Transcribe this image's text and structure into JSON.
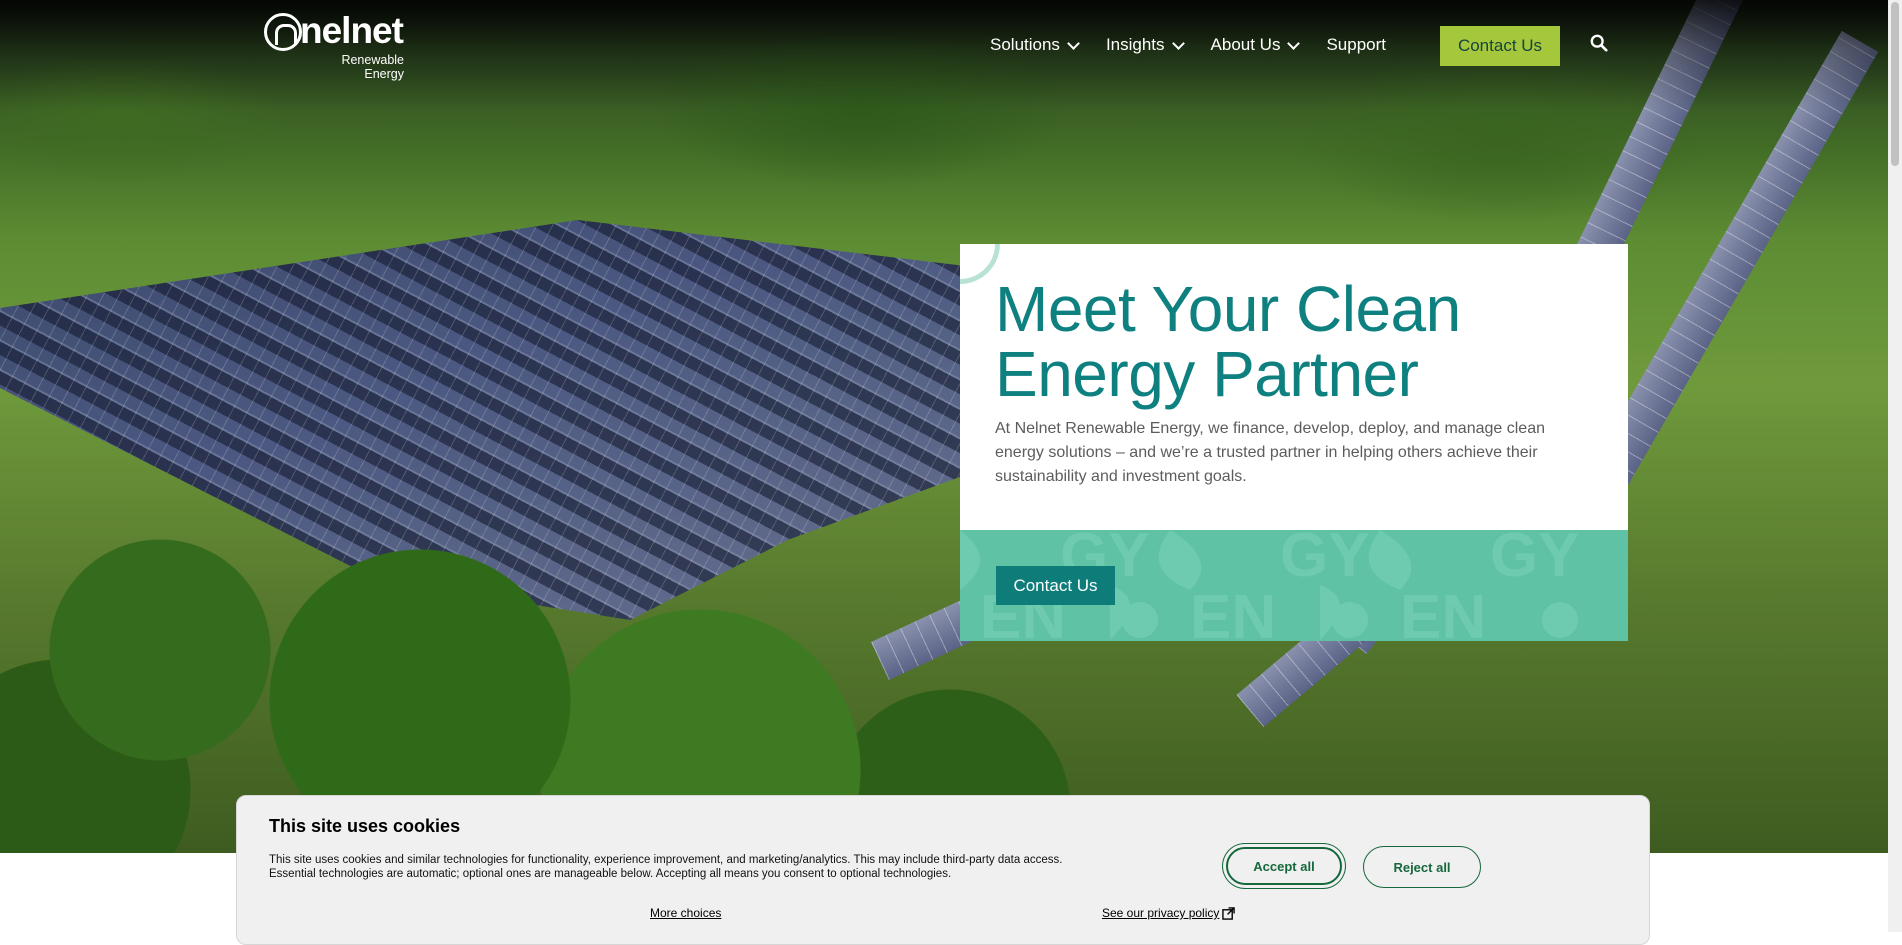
{
  "header": {
    "logo": {
      "word": "nelnet",
      "sub_line1": "Renewable",
      "sub_line2": "Energy"
    },
    "nav": [
      {
        "label": "Solutions",
        "has_dropdown": true
      },
      {
        "label": "Insights",
        "has_dropdown": true
      },
      {
        "label": "About Us",
        "has_dropdown": true
      },
      {
        "label": "Support",
        "has_dropdown": false
      }
    ],
    "contact_label": "Contact Us",
    "search_icon": "search-icon"
  },
  "hero": {
    "title": "Meet Your Clean Energy Partner",
    "description": "At Nelnet Renewable Energy, we finance, develop, deploy, and manage clean energy solutions – and we’re a trusted partner in helping others achieve their sustainability and investment goals.",
    "cta_label": "Contact Us",
    "pattern_text": [
      "GY",
      "EN",
      "GY",
      "EN",
      "GY",
      "EN"
    ]
  },
  "cookie": {
    "title": "This site uses cookies",
    "text": "This site uses cookies and similar technologies for functionality, experience improvement, and marketing/analytics. This may include third-party data access. Essential technologies are automatic; optional ones are manageable below. Accepting all means you consent to optional technologies.",
    "accept_label": "Accept all",
    "reject_label": "Reject all",
    "more_label": "More choices",
    "privacy_label": "See our privacy policy",
    "privacy_icon": "external-link-icon"
  },
  "colors": {
    "brand_teal": "#0e8080",
    "accent_green": "#a5c73b",
    "mint": "#5fc2a4",
    "cookie_green": "#15683c"
  }
}
